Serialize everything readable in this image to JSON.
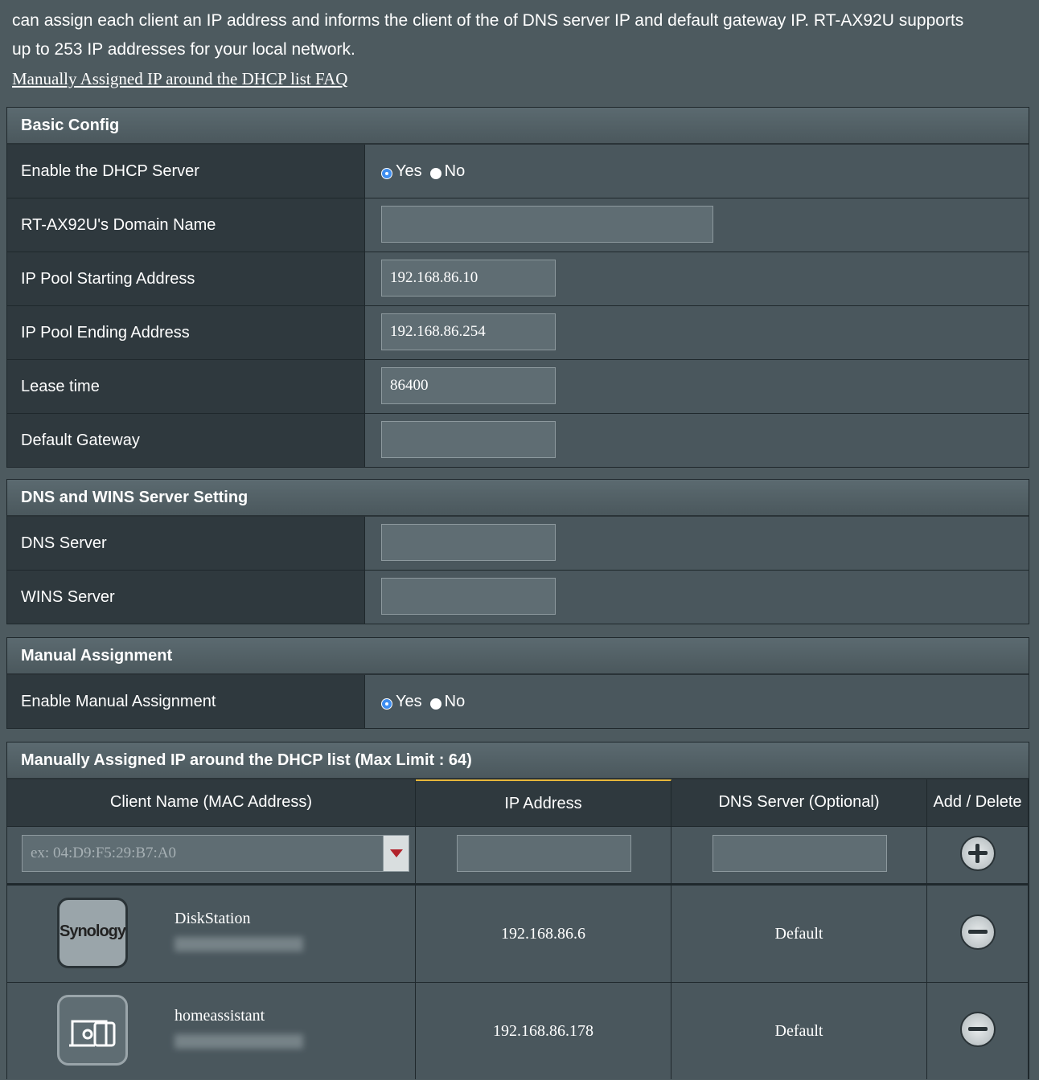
{
  "intro": {
    "line1": "can assign each client an IP address and informs the client of the of DNS server IP and default gateway IP. RT-AX92U supports",
    "line2": "up to 253 IP addresses for your local network.",
    "faq_link": "Manually Assigned IP around the DHCP list FAQ"
  },
  "basic_config": {
    "header": "Basic Config",
    "enable_dhcp": {
      "label": "Enable the DHCP Server",
      "yes": "Yes",
      "no": "No",
      "selected": "Yes"
    },
    "domain_name": {
      "label": "RT-AX92U's Domain Name",
      "value": ""
    },
    "pool_start": {
      "label": "IP Pool Starting Address",
      "value": "192.168.86.10"
    },
    "pool_end": {
      "label": "IP Pool Ending Address",
      "value": "192.168.86.254"
    },
    "lease_time": {
      "label": "Lease time",
      "value": "86400"
    },
    "default_gateway": {
      "label": "Default Gateway",
      "value": ""
    }
  },
  "dns_wins": {
    "header": "DNS and WINS Server Setting",
    "dns_server": {
      "label": "DNS Server",
      "value": ""
    },
    "wins_server": {
      "label": "WINS Server",
      "value": ""
    }
  },
  "manual_assignment": {
    "header": "Manual Assignment",
    "enable": {
      "label": "Enable Manual Assignment",
      "yes": "Yes",
      "no": "No",
      "selected": "Yes"
    }
  },
  "dhcp_list": {
    "header": "Manually Assigned IP around the DHCP list (Max Limit : 64)",
    "columns": [
      "Client Name (MAC Address)",
      "IP Address",
      "DNS Server (Optional)",
      "Add / Delete"
    ],
    "mac_placeholder": "ex: 04:D9:F5:29:B7:A0",
    "rows": [
      {
        "icon": "synology-icon",
        "icon_text": "Synology",
        "name": "DiskStation",
        "ip": "192.168.86.6",
        "dns": "Default"
      },
      {
        "icon": "device-icon",
        "icon_text": "",
        "name": "homeassistant",
        "ip": "192.168.86.178",
        "dns": "Default"
      }
    ]
  }
}
